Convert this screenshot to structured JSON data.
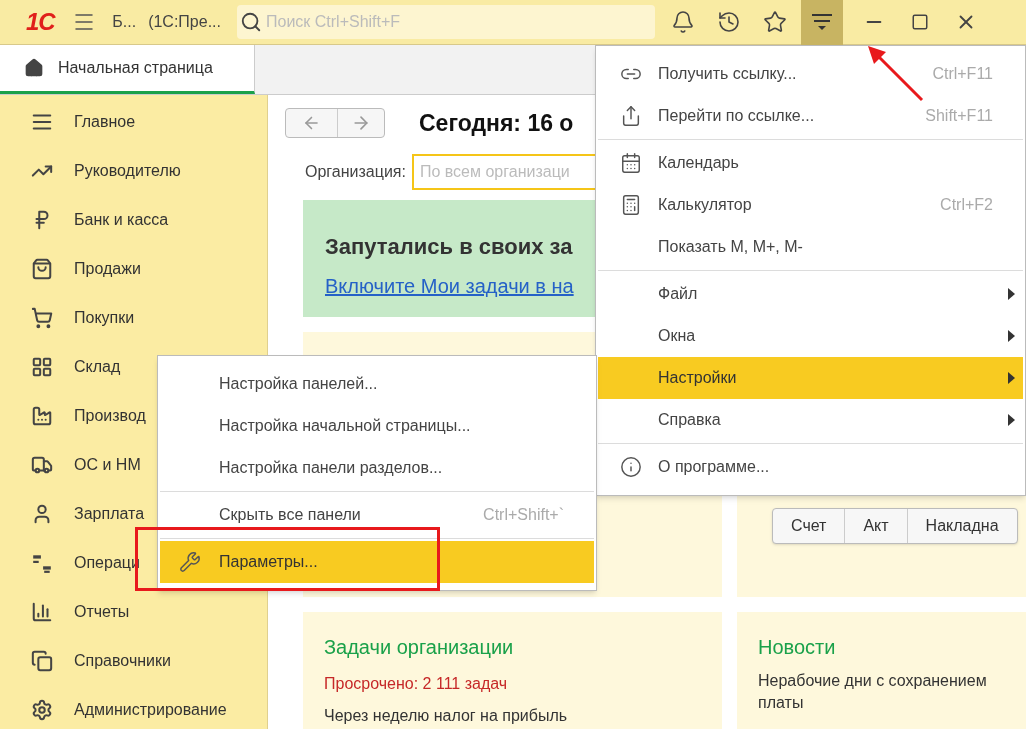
{
  "titlebar": {
    "logo": "1С",
    "title": "Б...",
    "subtitle": "(1С:Пре...",
    "search": {
      "placeholder": "Поиск Ctrl+Shift+F"
    },
    "menu_button": {
      "selected": true
    }
  },
  "tabs": [
    {
      "label": "Начальная страница",
      "selected": true
    }
  ],
  "sidebar": {
    "items": [
      "Главное",
      "Руководителю",
      "Банк и касса",
      "Продажи",
      "Покупки",
      "Склад",
      "Производ",
      "ОС и НМ",
      "Зарплата",
      "Операци",
      "Отчеты",
      "Справочники",
      "Администрирование"
    ]
  },
  "home": {
    "title": "Сегодня: 16 о",
    "organization": {
      "label": "Организация:",
      "placeholder": "По всем организаци"
    },
    "banner": {
      "title": "Запутались в своих за",
      "link": "Включите Мои задачи в на"
    },
    "document_buttons": [
      "Счет",
      "Акт",
      "Накладна"
    ],
    "tasks": {
      "title": "Задачи организации",
      "overdue": "Просрочено: 2 111 задач",
      "text": "Через неделю налог на прибыль"
    },
    "news": {
      "title": "Новости",
      "text": "Нерабочие дни с сохранением платы"
    }
  },
  "main_menu": {
    "groups": [
      [
        {
          "label": "Получить ссылку...",
          "shortcut": "Ctrl+F11",
          "has_submenu": false,
          "selected": false
        },
        {
          "label": "Перейти по ссылке...",
          "shortcut": "Shift+F11",
          "has_submenu": false,
          "selected": false
        }
      ],
      [
        {
          "label": "Календарь",
          "has_submenu": false,
          "selected": false
        },
        {
          "label": "Калькулятор",
          "shortcut": "Ctrl+F2",
          "has_submenu": false,
          "selected": false
        },
        {
          "label": "Показать М, М+, М-",
          "has_submenu": false,
          "selected": false
        }
      ],
      [
        {
          "label": "Файл",
          "has_submenu": true,
          "selected": false
        },
        {
          "label": "Окна",
          "has_submenu": true,
          "selected": false
        },
        {
          "label": "Настройки",
          "has_submenu": true,
          "selected": true
        },
        {
          "label": "Справка",
          "has_submenu": true,
          "selected": false
        }
      ],
      [
        {
          "label": "О программе...",
          "has_submenu": false,
          "selected": false
        }
      ]
    ]
  },
  "submenu": {
    "groups": [
      [
        {
          "label": "Настройка панелей...",
          "has_submenu": false,
          "selected": false
        },
        {
          "label": "Настройка начальной страницы...",
          "has_submenu": false,
          "selected": false
        },
        {
          "label": "Настройка панели разделов...",
          "has_submenu": false,
          "selected": false
        }
      ],
      [
        {
          "label": "Скрыть все панели",
          "shortcut": "Ctrl+Shift+`",
          "has_submenu": false,
          "selected": false
        }
      ],
      [
        {
          "label": "Параметры...",
          "has_submenu": false,
          "selected": true
        }
      ]
    ]
  }
}
